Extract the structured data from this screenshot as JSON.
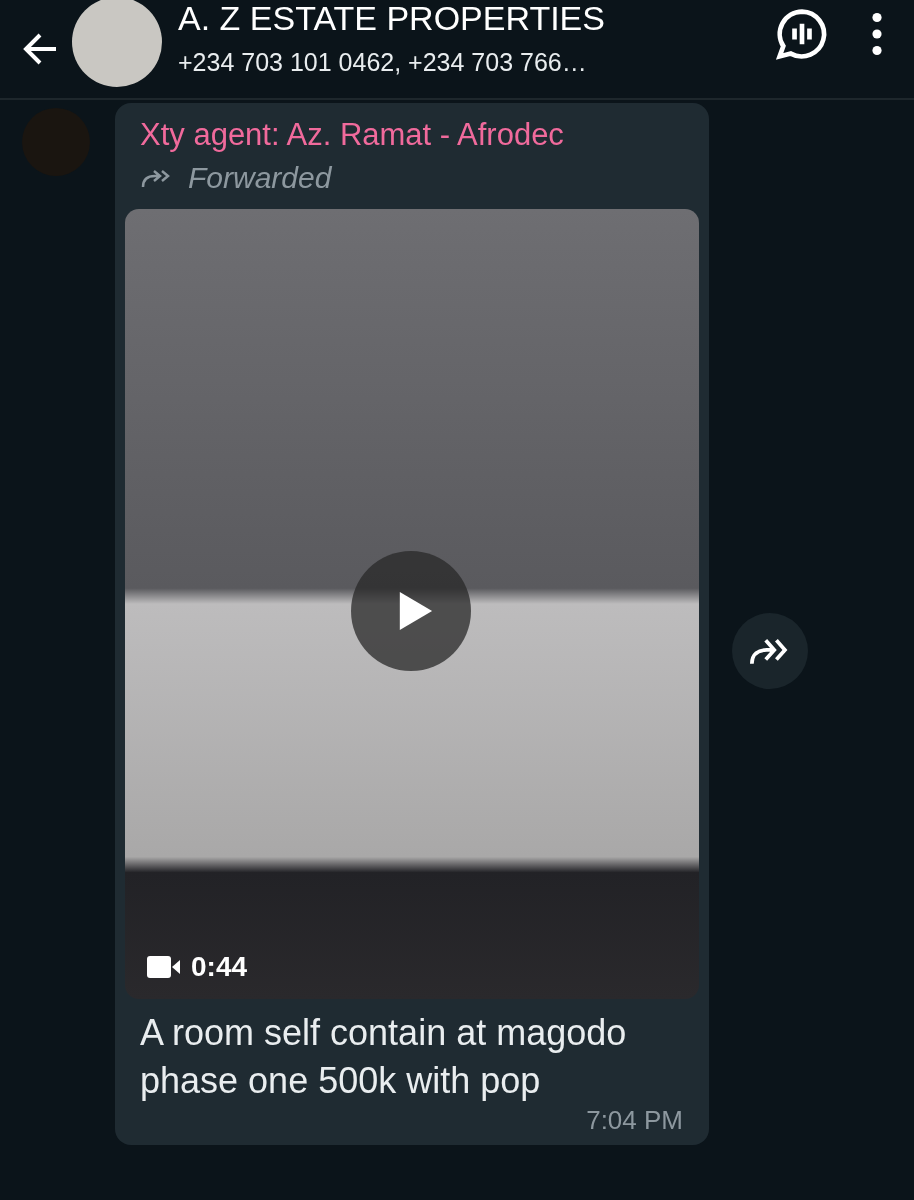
{
  "header": {
    "title": "A. Z ESTATE PROPERTIES",
    "subtitle": "+234 703 101 0462, +234 703 766…"
  },
  "message": {
    "sender": "Xty agent: Az. Ramat  - Afrodec",
    "forwarded": true,
    "forwarded_label": "Forwarded",
    "video": {
      "duration": "0:44"
    },
    "caption": "A room self contain at magodo phase one 500k with pop",
    "time": "7:04 PM"
  }
}
